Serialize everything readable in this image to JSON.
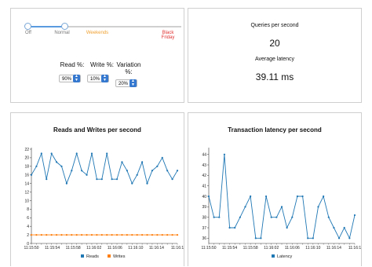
{
  "controls": {
    "scale": {
      "off": "Off",
      "normal": "Normal",
      "weekends": "Weekends",
      "black_friday_line1": "Black",
      "black_friday_line2": "Friday"
    },
    "load_level_fraction": 0.24,
    "reads": {
      "label": "Read %:",
      "value": "90%"
    },
    "writes": {
      "label": "Write %:",
      "value": "10%"
    },
    "variation": {
      "label_line1": "Variation",
      "label_line2": "%:",
      "value": "20%"
    }
  },
  "stats": {
    "qps_label": "Queries per second",
    "qps_value": "20",
    "latency_label": "Average latency",
    "latency_value": "39.11 ms"
  },
  "colors": {
    "reads": "#1f77b4",
    "writes": "#ff7f0e",
    "latency": "#1f77b4",
    "slider": "#5a9be0"
  },
  "chart_data": [
    {
      "type": "line",
      "title": "Reads and Writes per second",
      "x_tick_labels": [
        "11:15:50",
        "11:15:54",
        "11:15:58",
        "11:16:02",
        "11:16:06",
        "11:16:10",
        "11:16:14",
        "11:16:1"
      ],
      "y_ticks": [
        0,
        2,
        4,
        6,
        8,
        10,
        12,
        14,
        16,
        18,
        20,
        22
      ],
      "ylim": [
        0,
        22
      ],
      "series": [
        {
          "name": "Reads",
          "values": [
            16,
            18,
            21,
            15,
            21,
            19,
            18,
            14,
            17,
            21,
            17,
            16,
            21,
            15,
            15,
            21,
            15,
            15,
            19,
            17,
            14,
            16,
            19,
            14,
            17,
            18,
            20,
            17,
            15,
            17
          ]
        },
        {
          "name": "Writes",
          "values": [
            2,
            2,
            2,
            2,
            2,
            2,
            2,
            2,
            2,
            2,
            2,
            2,
            2,
            2,
            2,
            2,
            2,
            2,
            2,
            2,
            2,
            2,
            2,
            2,
            2,
            2,
            2,
            2,
            2,
            2
          ]
        }
      ]
    },
    {
      "type": "line",
      "title": "Transaction latency per second",
      "x_tick_labels": [
        "11:15:50",
        "11:15:54",
        "11:15:58",
        "11:16:02",
        "11:16:06",
        "11:16:10",
        "11:16:14",
        "11:16:1"
      ],
      "y_ticks": [
        36,
        37,
        38,
        39,
        40,
        41,
        42,
        43,
        44
      ],
      "ylim": [
        35.5,
        44.5
      ],
      "series": [
        {
          "name": "Latency",
          "values": [
            40,
            38,
            38,
            44,
            37,
            37,
            38,
            39,
            40,
            36,
            36,
            40,
            38,
            38,
            39,
            37,
            38,
            40,
            40,
            36,
            36,
            39,
            40,
            38,
            37,
            36,
            37,
            36,
            38.2
          ]
        }
      ]
    }
  ]
}
